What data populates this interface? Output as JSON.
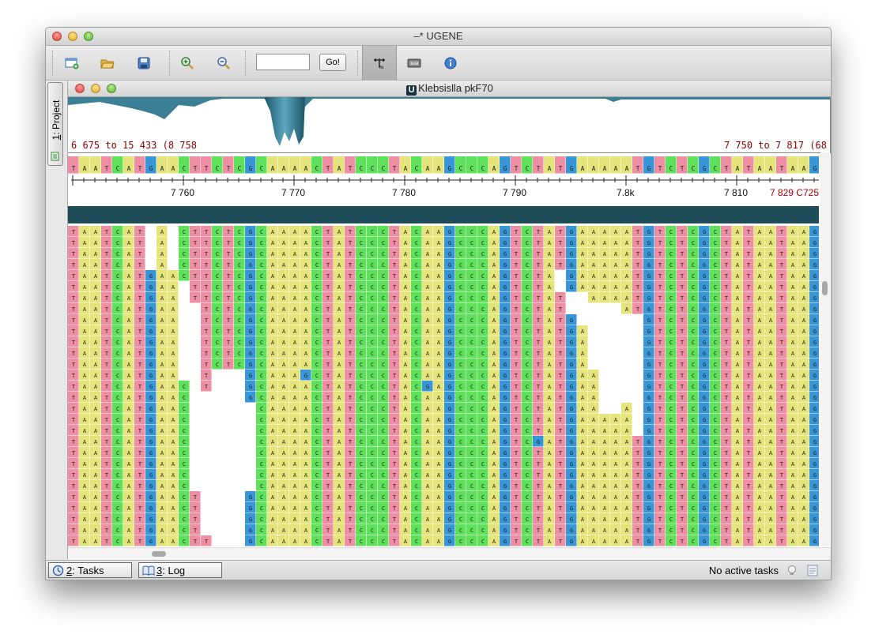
{
  "window": {
    "title": "–* UGENE"
  },
  "toolbar": {
    "buttons": [
      {
        "name": "new-project-icon"
      },
      {
        "name": "open-folder-icon"
      },
      {
        "name": "save-icon"
      },
      {
        "name": "zoom-in-icon"
      },
      {
        "name": "zoom-out-icon"
      }
    ],
    "position_value": "",
    "go_label": "Go!",
    "right_buttons": [
      {
        "name": "show-ruler-icon",
        "pressed": true
      },
      {
        "name": "bam-export-icon"
      },
      {
        "name": "info-icon"
      }
    ]
  },
  "sidebar": {
    "project_tab_num": "1",
    "project_tab_label": ": Project"
  },
  "assembly": {
    "title": "Klebsislla pkF70",
    "badge": "U",
    "range_left": "6 675 to 15 433 (8 758",
    "range_right": "7 750 to 7 817 (68",
    "ruler": {
      "tick_labels": [
        "7 760",
        "7 770",
        "7 780",
        "7 790",
        "7.8k",
        "7 810"
      ],
      "current": "7 829 C725"
    },
    "reference": "TAATCATGAACTTCTCGCAAAACTATCCCTACAAGCCCAGTCTATGAAAAATGTCTCGCTATAATAAGAA",
    "read_columns": [
      "TAATCAT",
      "TAATCATG",
      "TAATCATG",
      "TAATCATGA",
      "ACTTCTCG",
      "TTCTCG",
      "TCTCG",
      "GCAAAACTATCCCTACAAGCCCAGTCTATGA",
      "AAAATGTCTCGCTATAATAAGAA"
    ]
  },
  "colors": {
    "A": "#e4e47a",
    "C": "#5fe05a",
    "G": "#3896d6",
    "T": "#ee8ea2"
  },
  "status": {
    "tasks_num": "2",
    "tasks_label": ": Tasks",
    "log_num": "3",
    "log_label": ": Log",
    "message": "No active tasks"
  }
}
